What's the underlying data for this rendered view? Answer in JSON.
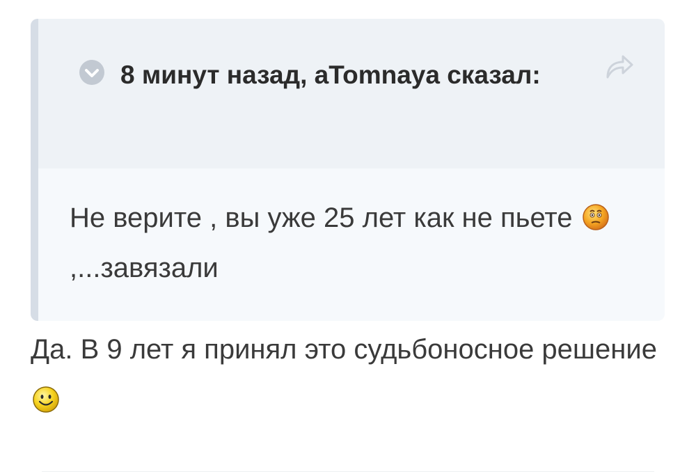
{
  "quote": {
    "header": {
      "time": "8 минут назад",
      "separator": ", ",
      "author": "aTomnaya",
      "said": "сказал:"
    },
    "body": {
      "text_before_emoji": "Не верите , вы уже 25 лет как не пьете ",
      "emoji": "thinking-smiley-icon",
      "text_after_emoji": ",...завязали"
    }
  },
  "reply": {
    "text": "Да. В 9 лет я принял это судьбоносное решение ",
    "emoji": "happy-smiley-icon"
  },
  "colors": {
    "quote_bar": "#d6dde6",
    "quote_header_bg": "#eef2f6",
    "quote_body_bg": "#f6f9fc",
    "icon_gray": "#c2c9d2",
    "text": "#3a3a3a"
  }
}
